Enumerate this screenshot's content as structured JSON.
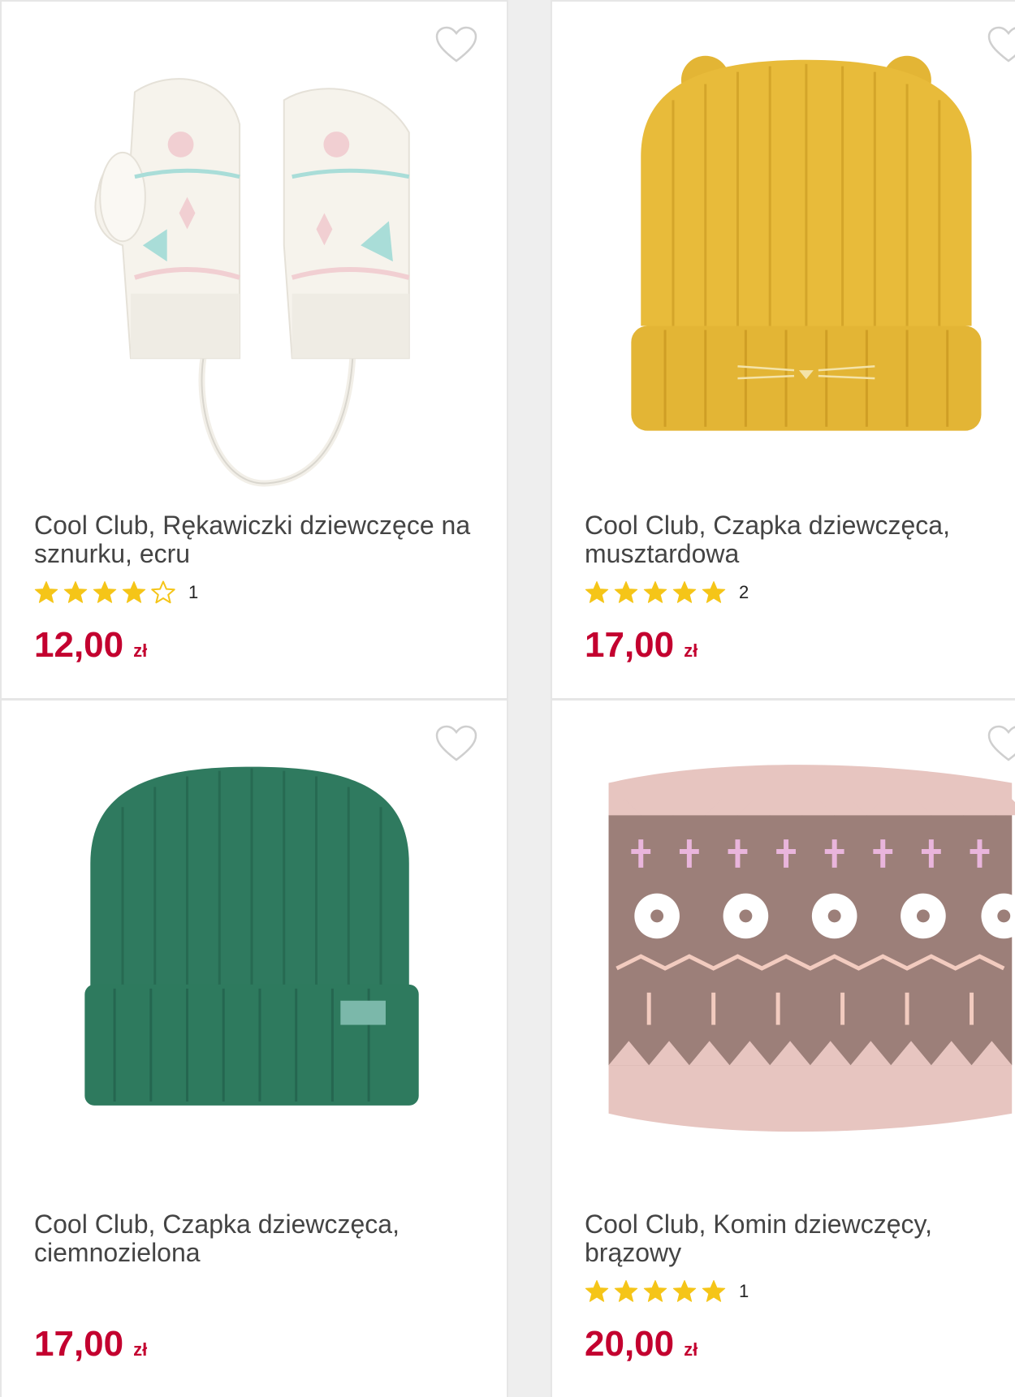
{
  "colors": {
    "price": "#c3002f",
    "star_filled": "#f5c518",
    "title_text": "#444444"
  },
  "products": [
    {
      "title": "Cool Club, Rękawiczki dziewczęce na sznurku, ecru",
      "rating_stars": 4,
      "rating_count": "1",
      "price": "12,00",
      "currency": "zł",
      "image": "mittens-image"
    },
    {
      "title": "Cool Club, Czapka dziewczęca, musztardowa",
      "rating_stars": 5,
      "rating_count": "2",
      "price": "17,00",
      "currency": "zł",
      "image": "mustard-hat-image"
    },
    {
      "title": "Cool Club, Czapka dziewczęca, ciemnozielona",
      "rating_stars": 0,
      "rating_count": "",
      "price": "17,00",
      "currency": "zł",
      "image": "green-hat-image"
    },
    {
      "title": "Cool Club, Komin dziewczęcy, brązowy",
      "rating_stars": 5,
      "rating_count": "1",
      "price": "20,00",
      "currency": "zł",
      "image": "snood-image"
    }
  ]
}
